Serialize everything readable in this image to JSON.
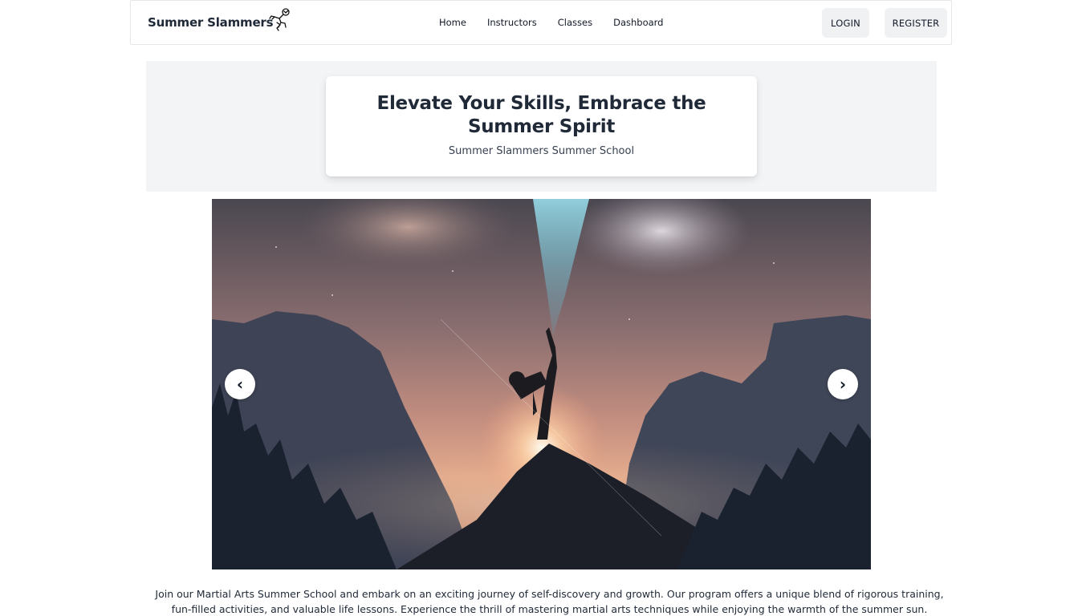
{
  "navbar": {
    "brand": "Summer Slammers",
    "links": [
      "Home",
      "Instructors",
      "Classes",
      "Dashboard"
    ],
    "login_label": "LOGIN",
    "register_label": "REGISTER"
  },
  "hero": {
    "title": "Elevate Your Skills, Embrace the Summer Spirit",
    "subtitle": "Summer Slammers Summer School"
  },
  "carousel": {
    "prev_label": "‹",
    "next_label": "›"
  },
  "description": "Join our Martial Arts Summer School and embark on an exciting journey of self-discovery and growth. Our program offers a unique blend of rigorous training, fun-filled activities, and valuable life lessons. Experience the thrill of mastering martial arts techniques while enjoying the warmth of the summer sun."
}
